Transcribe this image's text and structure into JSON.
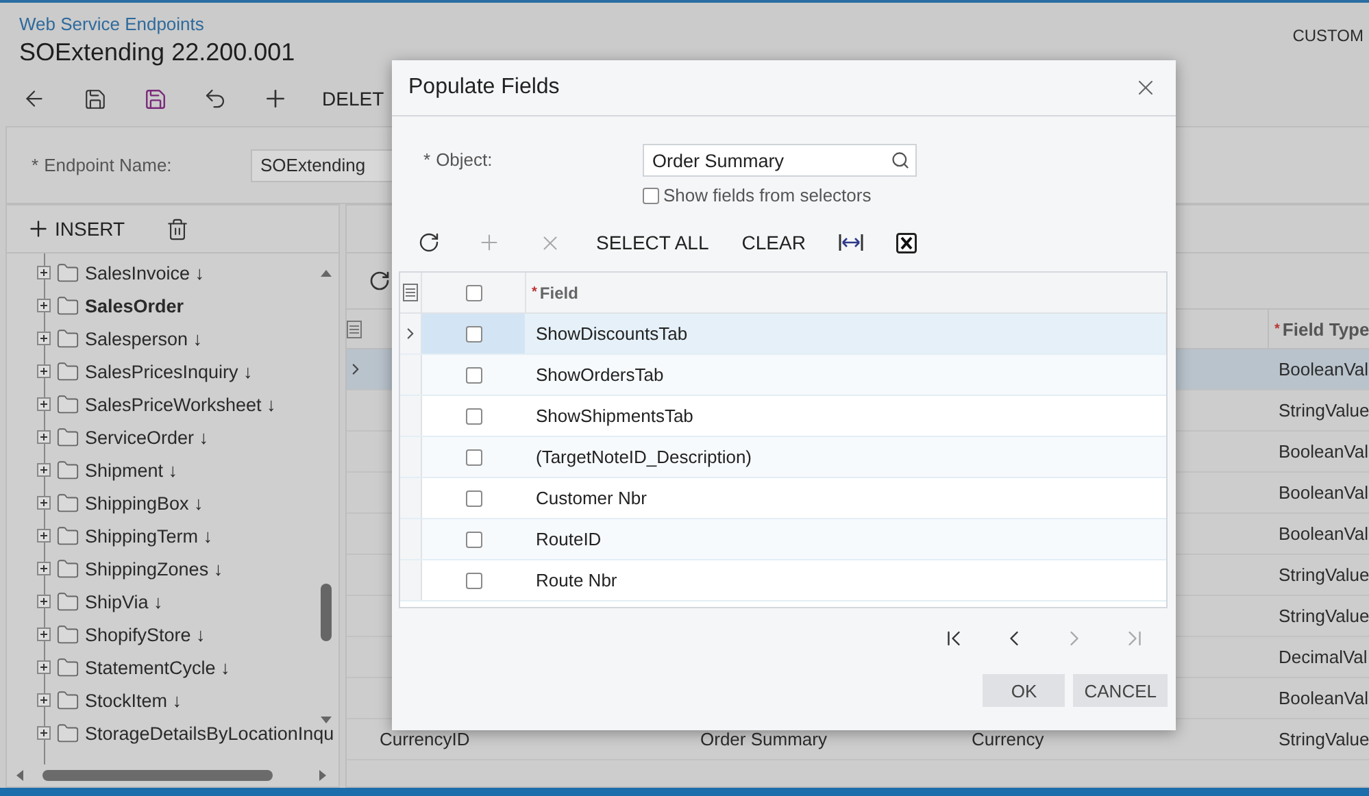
{
  "page": {
    "breadcrumb": "Web Service Endpoints",
    "title": "SOExtending 22.200.001",
    "top_right": "CUSTOM",
    "toolbar": [
      {
        "kind": "back"
      },
      {
        "kind": "save-close"
      },
      {
        "kind": "save"
      },
      {
        "kind": "undo"
      },
      {
        "kind": "add"
      },
      {
        "kind": "text",
        "label": "DELET"
      }
    ]
  },
  "form": {
    "mark": "*",
    "label": "Endpoint Name:",
    "value": "SOExtending"
  },
  "tree": {
    "insert": "INSERT",
    "items": [
      {
        "label": "SalesInvoice ↓",
        "bold": false
      },
      {
        "label": "SalesOrder",
        "bold": true
      },
      {
        "label": "Salesperson ↓",
        "bold": false
      },
      {
        "label": "SalesPricesInquiry ↓",
        "bold": false
      },
      {
        "label": "SalesPriceWorksheet ↓",
        "bold": false
      },
      {
        "label": "ServiceOrder ↓",
        "bold": false
      },
      {
        "label": "Shipment ↓",
        "bold": false
      },
      {
        "label": "ShippingBox ↓",
        "bold": false
      },
      {
        "label": "ShippingTerm ↓",
        "bold": false
      },
      {
        "label": "ShippingZones ↓",
        "bold": false
      },
      {
        "label": "ShipVia ↓",
        "bold": false
      },
      {
        "label": "ShopifyStore ↓",
        "bold": false
      },
      {
        "label": "StatementCycle ↓",
        "bold": false
      },
      {
        "label": "StockItem ↓",
        "bold": false
      },
      {
        "label": "StorageDetailsByLocationInqu",
        "bold": false
      }
    ]
  },
  "grid": {
    "header": {
      "mark": "*",
      "field_type": "Field Type"
    },
    "rows": [
      {
        "field_type": "BooleanVal",
        "selected": true
      },
      {
        "field_type": "StringValue",
        "selected": false
      },
      {
        "field_type": "BooleanVal",
        "selected": false
      },
      {
        "field_type": "BooleanVal",
        "selected": false
      },
      {
        "field_type": "BooleanVal",
        "selected": false
      },
      {
        "field_type": "StringValue",
        "selected": false
      },
      {
        "field_type": "StringValue",
        "selected": false
      },
      {
        "field_type": "DecimalVal",
        "selected": false
      },
      {
        "field_type": "BooleanVal",
        "selected": false
      },
      {
        "column_1": "CurrencyID",
        "column_2": "Order Summary",
        "column_3": "Currency",
        "field_type": "StringValue",
        "selected": false
      }
    ]
  },
  "dialog": {
    "title": "Populate Fields",
    "object": {
      "mark": "*",
      "label": "Object:",
      "value": "Order Summary"
    },
    "show_selectors": {
      "label": "Show fields from selectors",
      "checked": false
    },
    "toolbar": [
      {
        "kind": "refresh",
        "disabled": false
      },
      {
        "kind": "add",
        "disabled": true
      },
      {
        "kind": "delete",
        "disabled": true
      },
      {
        "kind": "text",
        "label": "SELECT ALL"
      },
      {
        "kind": "text",
        "label": "CLEAR"
      },
      {
        "kind": "fit"
      },
      {
        "kind": "excel"
      }
    ],
    "columns": {
      "mark": "*",
      "field": "Field",
      "all_checked": false
    },
    "rows": [
      {
        "field": "ShowDiscountsTab",
        "checked": false,
        "selected": true
      },
      {
        "field": "ShowOrdersTab",
        "checked": false,
        "selected": false
      },
      {
        "field": "ShowShipmentsTab",
        "checked": false,
        "selected": false
      },
      {
        "field": "(TargetNoteID_Description)",
        "checked": false,
        "selected": false
      },
      {
        "field": "Customer Nbr",
        "checked": false,
        "selected": false
      },
      {
        "field": "RouteID",
        "checked": false,
        "selected": false
      },
      {
        "field": "Route Nbr",
        "checked": false,
        "selected": false
      }
    ],
    "pager": [
      {
        "kind": "first",
        "disabled": false
      },
      {
        "kind": "prev",
        "disabled": false
      },
      {
        "kind": "next",
        "disabled": true
      },
      {
        "kind": "last",
        "disabled": true
      }
    ],
    "buttons": [
      "OK",
      "CANCEL"
    ]
  }
}
